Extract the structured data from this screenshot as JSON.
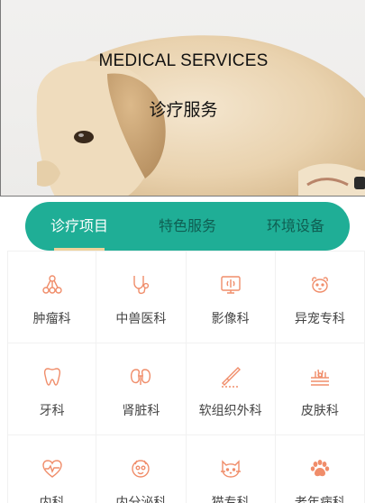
{
  "hero": {
    "title": "MEDICAL SERVICES",
    "subtitle": "诊疗服务"
  },
  "tabs": [
    {
      "label": "诊疗项目",
      "active": true
    },
    {
      "label": "特色服务",
      "active": false
    },
    {
      "label": "环境设备",
      "active": false
    }
  ],
  "services": [
    {
      "label": "肿瘤科",
      "icon": "tumor-icon"
    },
    {
      "label": "中兽医科",
      "icon": "stethoscope-icon"
    },
    {
      "label": "影像科",
      "icon": "xray-monitor-icon"
    },
    {
      "label": "异宠专科",
      "icon": "exotic-pet-icon"
    },
    {
      "label": "牙科",
      "icon": "tooth-icon"
    },
    {
      "label": "肾脏科",
      "icon": "kidney-icon"
    },
    {
      "label": "软组织外科",
      "icon": "scalpel-icon"
    },
    {
      "label": "皮肤科",
      "icon": "skin-icon"
    },
    {
      "label": "内科",
      "icon": "heart-pulse-icon"
    },
    {
      "label": "内分泌科",
      "icon": "endocrine-icon"
    },
    {
      "label": "猫专科",
      "icon": "cat-icon"
    },
    {
      "label": "老年病科",
      "icon": "paw-icon"
    }
  ],
  "colors": {
    "accent": "#1fae96",
    "tab_underline": "#efd29a",
    "icon": "#f08d6a"
  }
}
